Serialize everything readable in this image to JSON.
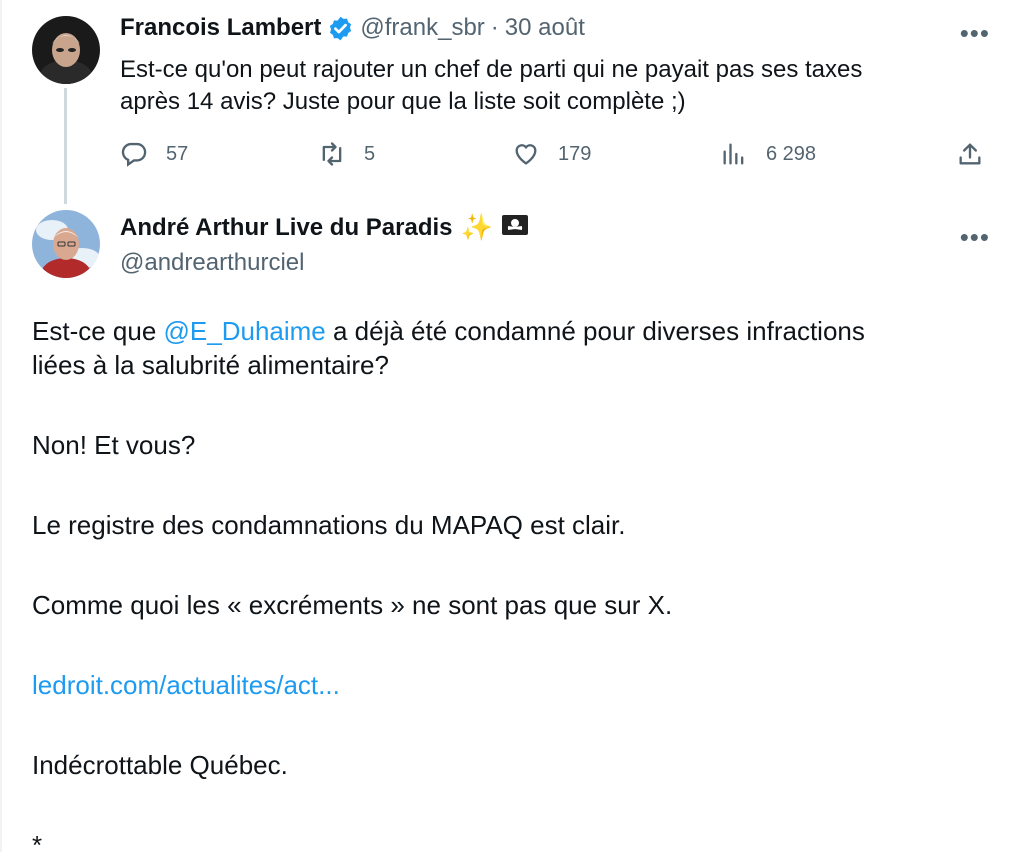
{
  "colors": {
    "link": "#1d9bf0",
    "muted": "#536471",
    "text": "#0f1419",
    "thread_line": "#cfd9de"
  },
  "tweet1": {
    "display_name": "Francois Lambert",
    "verified_icon": "verified-badge-icon",
    "handle": "@frank_sbr",
    "separator": "·",
    "date": "30 août",
    "more_label": "•••",
    "text_line1": "Est-ce qu'on peut rajouter un chef de parti qui ne payait pas ses taxes",
    "text_line2": "après 14 avis? Juste pour que la liste soit complète ;)",
    "actions": {
      "replies": "57",
      "reposts": "5",
      "likes": "179",
      "views": "6 298"
    }
  },
  "tweet2": {
    "display_name": "André Arthur Live du Paradis",
    "emoji_sparkles": "✨",
    "emoji_pirate_flag": "🏴‍☠️",
    "handle": "@andrearthurciel",
    "more_label": "•••",
    "para1_before": "Est-ce que ",
    "para1_mention": "@E_Duhaime",
    "para1_after_line1": " a déjà été condamné pour diverses infractions",
    "para1_line2": "liées à la salubrité alimentaire?",
    "para2": "Non! Et vous?",
    "para3": "Le registre des condamnations du MAPAQ est clair.",
    "para4": "Comme quoi les « excréments » ne sont pas que sur X.",
    "link": "ledroit.com/actualites/act...",
    "para5": "Indécrottable Québec.",
    "para6": "*"
  }
}
